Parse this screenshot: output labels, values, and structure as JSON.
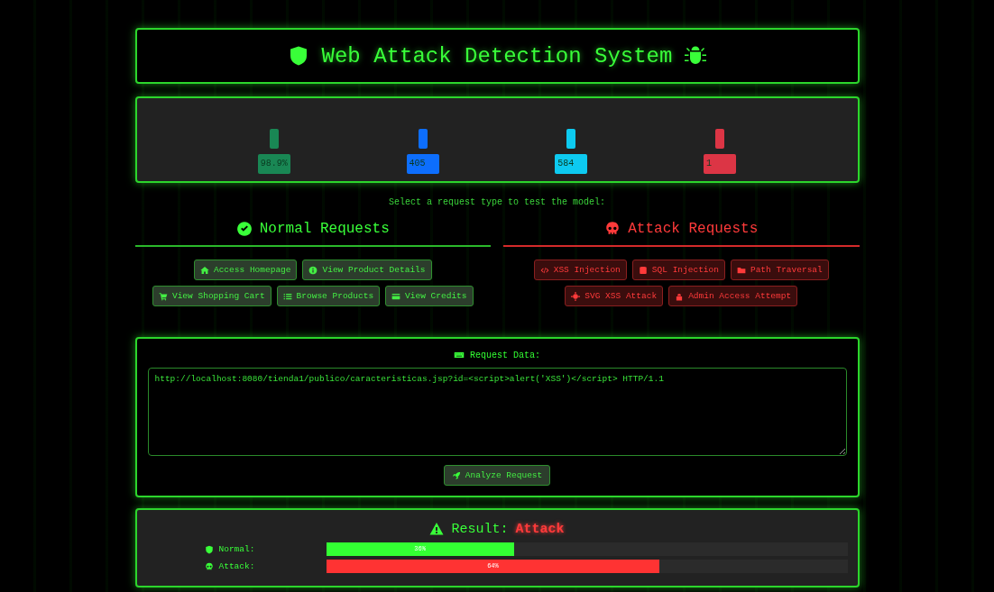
{
  "header": {
    "title": "Web Attack Detection System"
  },
  "stats": [
    {
      "value": "98.9%",
      "color": "#198754"
    },
    {
      "value": "405",
      "color": "#0d6efd"
    },
    {
      "value": "584",
      "color": "#0dcaf0"
    },
    {
      "value": "1",
      "color": "#dc3545"
    }
  ],
  "prompt": "Select a request type to test the model:",
  "groups": [
    {
      "kind": "normal",
      "title": "Normal Requests",
      "rows": [
        [
          "Access Homepage",
          "View Product Details"
        ],
        [
          "View Shopping Cart",
          "Browse Products",
          "View Credits"
        ]
      ]
    },
    {
      "kind": "attack",
      "title": "Attack Requests",
      "rows": [
        [
          "XSS Injection",
          "SQL Injection",
          "Path Traversal"
        ],
        [
          "SVG XSS Attack",
          "Admin Access Attempt"
        ]
      ]
    }
  ],
  "request": {
    "label": "Request Data:",
    "value": "http://localhost:8080/tienda1/publico/caracteristicas.jsp?id=<script>alert('XSS')</script> HTTP/1.1",
    "button": "Analyze Request"
  },
  "result": {
    "title": "Result:",
    "verdict": "Attack",
    "bars": [
      {
        "kind": "normal",
        "label": "Normal:",
        "level": 0.36,
        "reading": "36%"
      },
      {
        "kind": "attack",
        "label": "Attack:",
        "level": 0.64,
        "reading": "64%"
      }
    ]
  }
}
